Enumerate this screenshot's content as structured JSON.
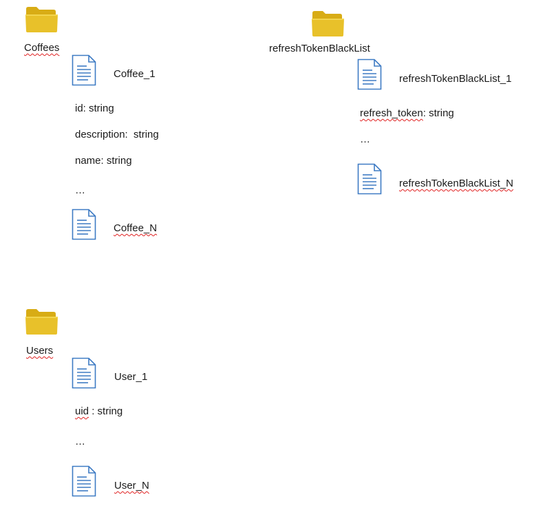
{
  "collections": {
    "coffees": {
      "label": "Coffees",
      "first_doc": "Coffee_1",
      "fields": [
        "id: string",
        "description:  string",
        "name: string"
      ],
      "ellipsis": "…",
      "last_doc": "Coffee_N"
    },
    "refresh": {
      "label": "refreshTokenBlackList",
      "first_doc": "refreshTokenBlackList_1",
      "field_name": "refresh_token",
      "field_type": ": string",
      "ellipsis": "…",
      "last_doc": "refreshTokenBlackList_N"
    },
    "users": {
      "label": "Users",
      "first_doc": "User_1",
      "field_name": "uid",
      "field_type": " : string",
      "ellipsis": "…",
      "last_doc": "User_N"
    }
  },
  "icons": {
    "folder": "folder-icon",
    "document": "document-icon"
  },
  "colors": {
    "folder_fill": "#e8c12a",
    "folder_back": "#d8ac15",
    "doc_outline": "#3e7bc4",
    "doc_lines": "#3e7bc4",
    "spellcheck": "#e02020"
  }
}
